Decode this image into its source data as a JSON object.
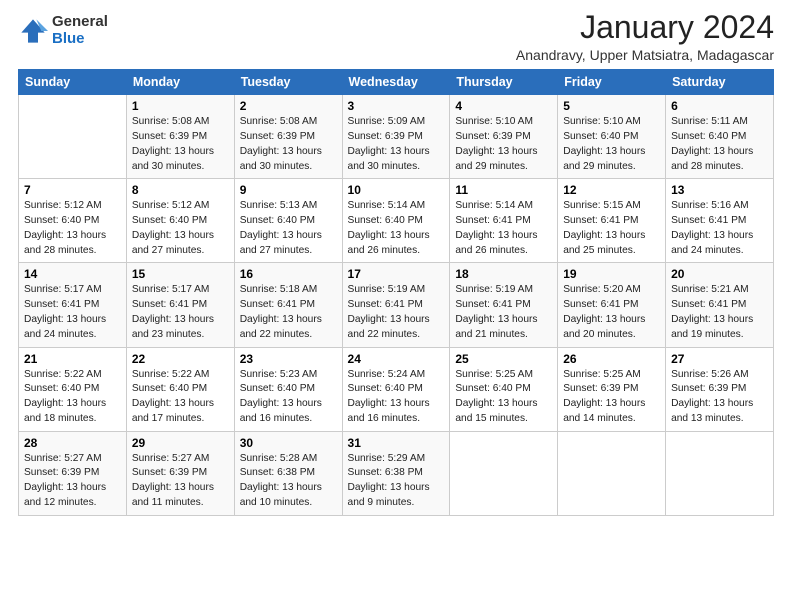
{
  "logo": {
    "general": "General",
    "blue": "Blue"
  },
  "header": {
    "month": "January 2024",
    "location": "Anandravy, Upper Matsiatra, Madagascar"
  },
  "days_of_week": [
    "Sunday",
    "Monday",
    "Tuesday",
    "Wednesday",
    "Thursday",
    "Friday",
    "Saturday"
  ],
  "weeks": [
    [
      {
        "day": "",
        "sunrise": "",
        "sunset": "",
        "daylight": ""
      },
      {
        "day": "1",
        "sunrise": "Sunrise: 5:08 AM",
        "sunset": "Sunset: 6:39 PM",
        "daylight": "Daylight: 13 hours and 30 minutes."
      },
      {
        "day": "2",
        "sunrise": "Sunrise: 5:08 AM",
        "sunset": "Sunset: 6:39 PM",
        "daylight": "Daylight: 13 hours and 30 minutes."
      },
      {
        "day": "3",
        "sunrise": "Sunrise: 5:09 AM",
        "sunset": "Sunset: 6:39 PM",
        "daylight": "Daylight: 13 hours and 30 minutes."
      },
      {
        "day": "4",
        "sunrise": "Sunrise: 5:10 AM",
        "sunset": "Sunset: 6:39 PM",
        "daylight": "Daylight: 13 hours and 29 minutes."
      },
      {
        "day": "5",
        "sunrise": "Sunrise: 5:10 AM",
        "sunset": "Sunset: 6:40 PM",
        "daylight": "Daylight: 13 hours and 29 minutes."
      },
      {
        "day": "6",
        "sunrise": "Sunrise: 5:11 AM",
        "sunset": "Sunset: 6:40 PM",
        "daylight": "Daylight: 13 hours and 28 minutes."
      }
    ],
    [
      {
        "day": "7",
        "sunrise": "Sunrise: 5:12 AM",
        "sunset": "Sunset: 6:40 PM",
        "daylight": "Daylight: 13 hours and 28 minutes."
      },
      {
        "day": "8",
        "sunrise": "Sunrise: 5:12 AM",
        "sunset": "Sunset: 6:40 PM",
        "daylight": "Daylight: 13 hours and 27 minutes."
      },
      {
        "day": "9",
        "sunrise": "Sunrise: 5:13 AM",
        "sunset": "Sunset: 6:40 PM",
        "daylight": "Daylight: 13 hours and 27 minutes."
      },
      {
        "day": "10",
        "sunrise": "Sunrise: 5:14 AM",
        "sunset": "Sunset: 6:40 PM",
        "daylight": "Daylight: 13 hours and 26 minutes."
      },
      {
        "day": "11",
        "sunrise": "Sunrise: 5:14 AM",
        "sunset": "Sunset: 6:41 PM",
        "daylight": "Daylight: 13 hours and 26 minutes."
      },
      {
        "day": "12",
        "sunrise": "Sunrise: 5:15 AM",
        "sunset": "Sunset: 6:41 PM",
        "daylight": "Daylight: 13 hours and 25 minutes."
      },
      {
        "day": "13",
        "sunrise": "Sunrise: 5:16 AM",
        "sunset": "Sunset: 6:41 PM",
        "daylight": "Daylight: 13 hours and 24 minutes."
      }
    ],
    [
      {
        "day": "14",
        "sunrise": "Sunrise: 5:17 AM",
        "sunset": "Sunset: 6:41 PM",
        "daylight": "Daylight: 13 hours and 24 minutes."
      },
      {
        "day": "15",
        "sunrise": "Sunrise: 5:17 AM",
        "sunset": "Sunset: 6:41 PM",
        "daylight": "Daylight: 13 hours and 23 minutes."
      },
      {
        "day": "16",
        "sunrise": "Sunrise: 5:18 AM",
        "sunset": "Sunset: 6:41 PM",
        "daylight": "Daylight: 13 hours and 22 minutes."
      },
      {
        "day": "17",
        "sunrise": "Sunrise: 5:19 AM",
        "sunset": "Sunset: 6:41 PM",
        "daylight": "Daylight: 13 hours and 22 minutes."
      },
      {
        "day": "18",
        "sunrise": "Sunrise: 5:19 AM",
        "sunset": "Sunset: 6:41 PM",
        "daylight": "Daylight: 13 hours and 21 minutes."
      },
      {
        "day": "19",
        "sunrise": "Sunrise: 5:20 AM",
        "sunset": "Sunset: 6:41 PM",
        "daylight": "Daylight: 13 hours and 20 minutes."
      },
      {
        "day": "20",
        "sunrise": "Sunrise: 5:21 AM",
        "sunset": "Sunset: 6:41 PM",
        "daylight": "Daylight: 13 hours and 19 minutes."
      }
    ],
    [
      {
        "day": "21",
        "sunrise": "Sunrise: 5:22 AM",
        "sunset": "Sunset: 6:40 PM",
        "daylight": "Daylight: 13 hours and 18 minutes."
      },
      {
        "day": "22",
        "sunrise": "Sunrise: 5:22 AM",
        "sunset": "Sunset: 6:40 PM",
        "daylight": "Daylight: 13 hours and 17 minutes."
      },
      {
        "day": "23",
        "sunrise": "Sunrise: 5:23 AM",
        "sunset": "Sunset: 6:40 PM",
        "daylight": "Daylight: 13 hours and 16 minutes."
      },
      {
        "day": "24",
        "sunrise": "Sunrise: 5:24 AM",
        "sunset": "Sunset: 6:40 PM",
        "daylight": "Daylight: 13 hours and 16 minutes."
      },
      {
        "day": "25",
        "sunrise": "Sunrise: 5:25 AM",
        "sunset": "Sunset: 6:40 PM",
        "daylight": "Daylight: 13 hours and 15 minutes."
      },
      {
        "day": "26",
        "sunrise": "Sunrise: 5:25 AM",
        "sunset": "Sunset: 6:39 PM",
        "daylight": "Daylight: 13 hours and 14 minutes."
      },
      {
        "day": "27",
        "sunrise": "Sunrise: 5:26 AM",
        "sunset": "Sunset: 6:39 PM",
        "daylight": "Daylight: 13 hours and 13 minutes."
      }
    ],
    [
      {
        "day": "28",
        "sunrise": "Sunrise: 5:27 AM",
        "sunset": "Sunset: 6:39 PM",
        "daylight": "Daylight: 13 hours and 12 minutes."
      },
      {
        "day": "29",
        "sunrise": "Sunrise: 5:27 AM",
        "sunset": "Sunset: 6:39 PM",
        "daylight": "Daylight: 13 hours and 11 minutes."
      },
      {
        "day": "30",
        "sunrise": "Sunrise: 5:28 AM",
        "sunset": "Sunset: 6:38 PM",
        "daylight": "Daylight: 13 hours and 10 minutes."
      },
      {
        "day": "31",
        "sunrise": "Sunrise: 5:29 AM",
        "sunset": "Sunset: 6:38 PM",
        "daylight": "Daylight: 13 hours and 9 minutes."
      },
      {
        "day": "",
        "sunrise": "",
        "sunset": "",
        "daylight": ""
      },
      {
        "day": "",
        "sunrise": "",
        "sunset": "",
        "daylight": ""
      },
      {
        "day": "",
        "sunrise": "",
        "sunset": "",
        "daylight": ""
      }
    ]
  ]
}
